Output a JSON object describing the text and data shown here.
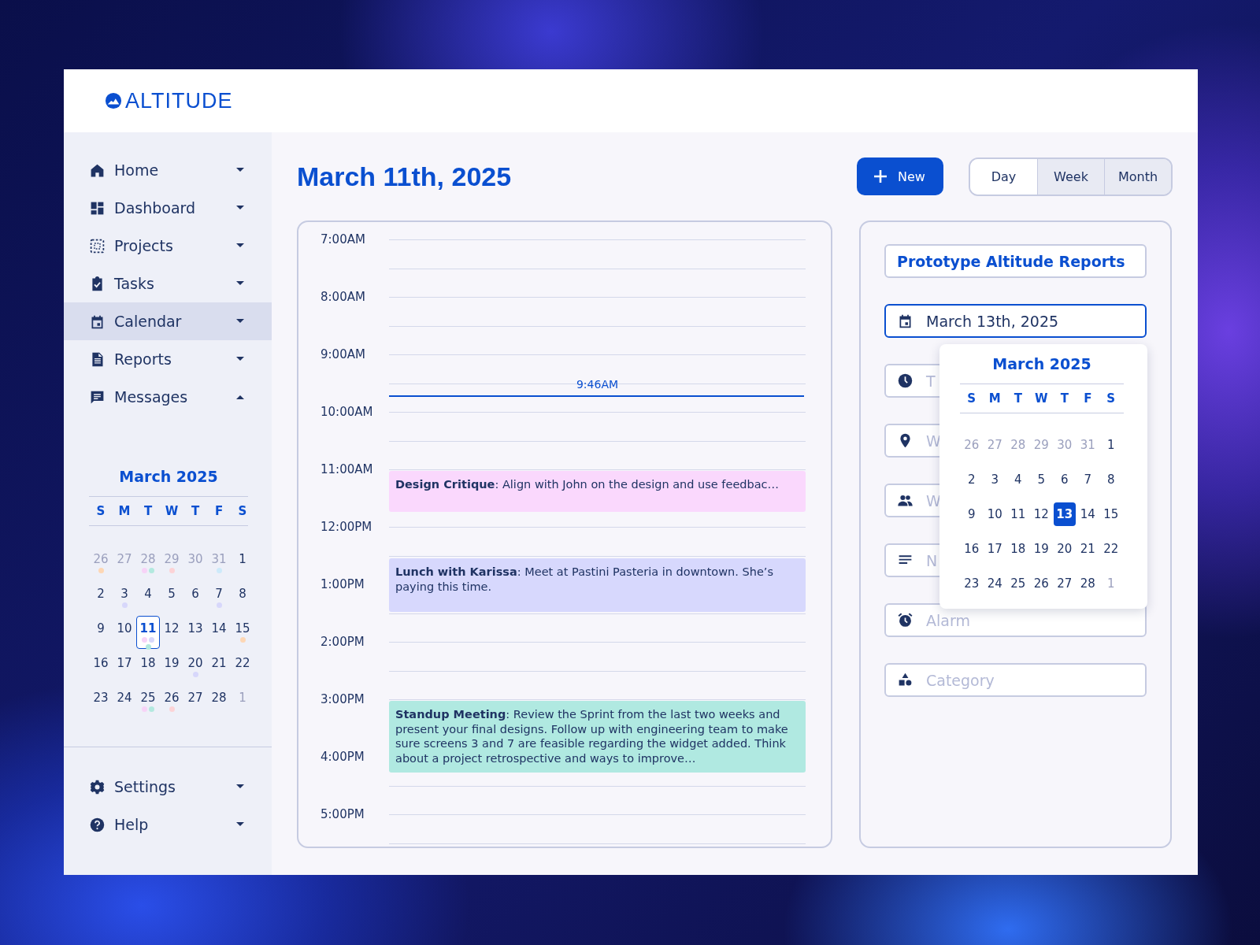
{
  "brand": {
    "name": "ALTITUDE"
  },
  "sidebar": {
    "items": [
      {
        "label": "Home",
        "selected": false,
        "expanded": false
      },
      {
        "label": "Dashboard",
        "selected": false,
        "expanded": false
      },
      {
        "label": "Projects",
        "selected": false,
        "expanded": false
      },
      {
        "label": "Tasks",
        "selected": false,
        "expanded": false
      },
      {
        "label": "Calendar",
        "selected": true,
        "expanded": false
      },
      {
        "label": "Reports",
        "selected": false,
        "expanded": false
      },
      {
        "label": "Messages",
        "selected": false,
        "expanded": true
      }
    ],
    "calendar": {
      "title": "March 2025",
      "weekdays": [
        "S",
        "M",
        "T",
        "W",
        "T",
        "F",
        "S"
      ],
      "days": [
        {
          "label": "26",
          "muted": true,
          "selected": false,
          "dots": [
            {
              "color": "#fdd7b5"
            }
          ]
        },
        {
          "label": "27",
          "muted": true,
          "selected": false
        },
        {
          "label": "28",
          "muted": true,
          "selected": false,
          "dots": [
            {
              "color": "#f7d3f7"
            },
            {
              "color": "#b3e9df"
            }
          ]
        },
        {
          "label": "29",
          "muted": true,
          "selected": false,
          "dots": [
            {
              "color": "#fcd3d6"
            }
          ]
        },
        {
          "label": "30",
          "muted": true,
          "selected": false
        },
        {
          "label": "31",
          "muted": true,
          "selected": false,
          "dots": [
            {
              "color": "#cdeafa"
            }
          ]
        },
        {
          "label": "1",
          "muted": false,
          "selected": false
        },
        {
          "label": "2",
          "muted": false,
          "selected": false
        },
        {
          "label": "3",
          "muted": false,
          "selected": false,
          "dots": [
            {
              "color": "#d7d7fb"
            }
          ]
        },
        {
          "label": "4",
          "muted": false,
          "selected": false
        },
        {
          "label": "5",
          "muted": false,
          "selected": false
        },
        {
          "label": "6",
          "muted": false,
          "selected": false
        },
        {
          "label": "7",
          "muted": false,
          "selected": false,
          "dots": [
            {
              "color": "#d7d7fb"
            }
          ]
        },
        {
          "label": "8",
          "muted": false,
          "selected": false
        },
        {
          "label": "9",
          "muted": false,
          "selected": false
        },
        {
          "label": "10",
          "muted": false,
          "selected": false
        },
        {
          "label": "11",
          "muted": false,
          "selected": true,
          "dots": [
            {
              "color": "#f7d3f7"
            },
            {
              "color": "#d7d7fb"
            },
            {
              "color": "#b3e9df"
            }
          ]
        },
        {
          "label": "12",
          "muted": false,
          "selected": false
        },
        {
          "label": "13",
          "muted": false,
          "selected": false
        },
        {
          "label": "14",
          "muted": false,
          "selected": false
        },
        {
          "label": "15",
          "muted": false,
          "selected": false,
          "dots": [
            {
              "color": "#fdd7b5"
            }
          ]
        },
        {
          "label": "16",
          "muted": false,
          "selected": false
        },
        {
          "label": "17",
          "muted": false,
          "selected": false
        },
        {
          "label": "18",
          "muted": false,
          "selected": false
        },
        {
          "label": "19",
          "muted": false,
          "selected": false
        },
        {
          "label": "20",
          "muted": false,
          "selected": false,
          "dots": [
            {
              "color": "#d7d7fb"
            }
          ]
        },
        {
          "label": "21",
          "muted": false,
          "selected": false
        },
        {
          "label": "22",
          "muted": false,
          "selected": false
        },
        {
          "label": "23",
          "muted": false,
          "selected": false
        },
        {
          "label": "24",
          "muted": false,
          "selected": false
        },
        {
          "label": "25",
          "muted": false,
          "selected": false,
          "dots": [
            {
              "color": "#f7d3f7"
            },
            {
              "color": "#b3e9df"
            }
          ]
        },
        {
          "label": "26",
          "muted": false,
          "selected": false,
          "dots": [
            {
              "color": "#fcd3d6"
            }
          ]
        },
        {
          "label": "27",
          "muted": false,
          "selected": false
        },
        {
          "label": "28",
          "muted": false,
          "selected": false
        },
        {
          "label": "1",
          "muted": true,
          "selected": false
        }
      ]
    },
    "bottom_items": [
      {
        "label": "Settings",
        "expanded": false
      },
      {
        "label": "Help",
        "expanded": false
      }
    ]
  },
  "main": {
    "title": "March 11th, 2025",
    "new_button": {
      "label": "New"
    },
    "view_tabs": [
      {
        "label": "Day",
        "selected": true
      },
      {
        "label": "Week",
        "selected": false
      },
      {
        "label": "Month",
        "selected": false
      }
    ],
    "timeline": {
      "hours": [
        {
          "label": "7:00AM"
        },
        {
          "label": "8:00AM"
        },
        {
          "label": "9:00AM",
          "now_marker": {
            "label": "9:46AM"
          }
        },
        {
          "label": "10:00AM"
        },
        {
          "label": "11:00AM",
          "events": [
            {
              "text": "**Design Critique**: Align with John on the design and use feedbac…",
              "color": "#fad8fd"
            }
          ]
        },
        {
          "label": "12:00PM",
          "late_events": [
            {
              "text": "**Lunch with Karissa**: Meet at Pastini Pasteria in downtown. She’s paying this time.",
              "color": "#d7d8fd"
            }
          ]
        },
        {
          "label": "1:00PM"
        },
        {
          "label": "2:00PM"
        },
        {
          "label": "3:00PM",
          "events": [
            {
              "text": "**Standup Meeting**: Review the Sprint from the last two weeks and present your final designs. Follow up with engineering team to make sure screens 3 and 7 are feasible regarding the widget added. Think about a project retrospective and ways to improve…",
              "color": "#b0e9e1"
            }
          ]
        },
        {
          "label": "4:00PM"
        },
        {
          "label": "5:00PM"
        }
      ]
    }
  },
  "event_form": {
    "title_field": {
      "value": "Prototype Altitude Reports"
    },
    "date_field": {
      "value": "March 13th, 2025",
      "focused": true
    },
    "fields": [
      {
        "placeholder": "T"
      },
      {
        "placeholder": "W"
      },
      {
        "placeholder": "W"
      },
      {
        "placeholder": "N"
      },
      {
        "placeholder": "Alarm"
      },
      {
        "placeholder": "Category"
      }
    ],
    "date_picker": {
      "title": "March 2025",
      "weekdays": [
        "S",
        "M",
        "T",
        "W",
        "T",
        "F",
        "S"
      ],
      "days": [
        {
          "label": "26",
          "muted": true,
          "selected": false
        },
        {
          "label": "27",
          "muted": true,
          "selected": false
        },
        {
          "label": "28",
          "muted": true,
          "selected": false
        },
        {
          "label": "29",
          "muted": true,
          "selected": false
        },
        {
          "label": "30",
          "muted": true,
          "selected": false
        },
        {
          "label": "31",
          "muted": true,
          "selected": false
        },
        {
          "label": "1",
          "muted": false,
          "selected": false
        },
        {
          "label": "2",
          "muted": false,
          "selected": false
        },
        {
          "label": "3",
          "muted": false,
          "selected": false
        },
        {
          "label": "4",
          "muted": false,
          "selected": false
        },
        {
          "label": "5",
          "muted": false,
          "selected": false
        },
        {
          "label": "6",
          "muted": false,
          "selected": false
        },
        {
          "label": "7",
          "muted": false,
          "selected": false
        },
        {
          "label": "8",
          "muted": false,
          "selected": false
        },
        {
          "label": "9",
          "muted": false,
          "selected": false
        },
        {
          "label": "10",
          "muted": false,
          "selected": false
        },
        {
          "label": "11",
          "muted": false,
          "selected": false
        },
        {
          "label": "12",
          "muted": false,
          "selected": false
        },
        {
          "label": "13",
          "muted": false,
          "selected": true
        },
        {
          "label": "14",
          "muted": false,
          "selected": false
        },
        {
          "label": "15",
          "muted": false,
          "selected": false
        },
        {
          "label": "16",
          "muted": false,
          "selected": false
        },
        {
          "label": "17",
          "muted": false,
          "selected": false
        },
        {
          "label": "18",
          "muted": false,
          "selected": false
        },
        {
          "label": "19",
          "muted": false,
          "selected": false
        },
        {
          "label": "20",
          "muted": false,
          "selected": false
        },
        {
          "label": "21",
          "muted": false,
          "selected": false
        },
        {
          "label": "22",
          "muted": false,
          "selected": false
        },
        {
          "label": "23",
          "muted": false,
          "selected": false
        },
        {
          "label": "24",
          "muted": false,
          "selected": false
        },
        {
          "label": "25",
          "muted": false,
          "selected": false
        },
        {
          "label": "26",
          "muted": false,
          "selected": false
        },
        {
          "label": "27",
          "muted": false,
          "selected": false
        },
        {
          "label": "28",
          "muted": false,
          "selected": false
        },
        {
          "label": "1",
          "muted": true,
          "selected": false
        }
      ]
    }
  }
}
